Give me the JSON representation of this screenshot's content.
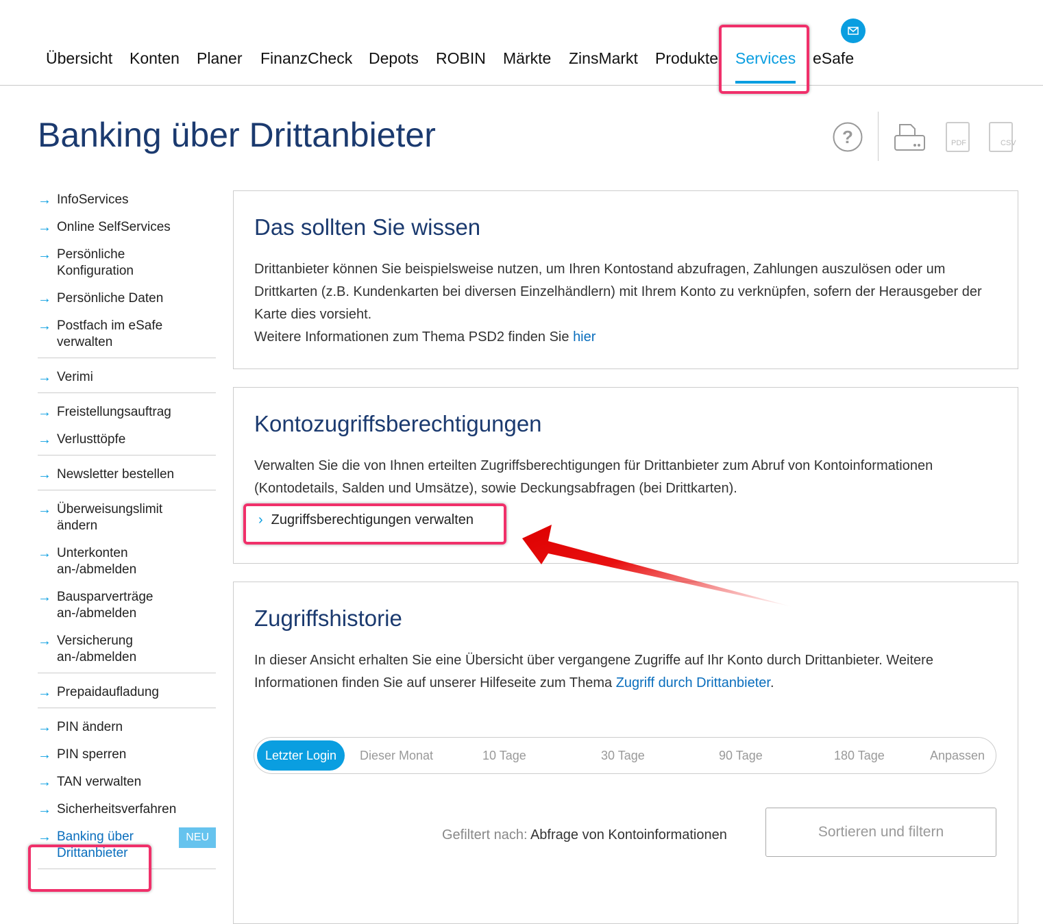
{
  "nav": {
    "items": [
      "Übersicht",
      "Konten",
      "Planer",
      "FinanzCheck",
      "Depots",
      "ROBIN",
      "Märkte",
      "ZinsMarkt",
      "Produkte",
      "Services",
      "eSafe"
    ],
    "active": "Services"
  },
  "page_title": "Banking über Drittanbieter",
  "tools": {
    "pdf": "PDF",
    "csv": "CSV",
    "help": "?"
  },
  "sidebar": {
    "groups": [
      [
        "InfoServices",
        "Online SelfServices",
        "Persönliche\nKonfiguration",
        "Persönliche Daten",
        "Postfach im eSafe\nverwalten"
      ],
      [
        "Verimi"
      ],
      [
        "Freistellungsauftrag",
        "Verlusttöpfe"
      ],
      [
        "Newsletter bestellen"
      ],
      [
        "Überweisungslimit\nändern",
        "Unterkonten\nan-/abmelden",
        "Bausparverträge\nan-/abmelden",
        "Versicherung\nan-/abmelden"
      ],
      [
        "Prepaidaufladung"
      ],
      [
        "PIN ändern",
        "PIN sperren",
        "TAN verwalten",
        "Sicherheitsverfahren",
        "Banking über\nDrittanbieter"
      ]
    ],
    "active": "Banking über\nDrittanbieter",
    "badge": "NEU"
  },
  "card1": {
    "title": "Das sollten Sie wissen",
    "text": "Drittanbieter können Sie beispielsweise nutzen, um Ihren Kontostand abzufragen, Zahlungen auszulösen oder um Drittkarten (z.B. Kundenkarten bei diversen Einzelhändlern) mit Ihrem Konto zu verknüpfen, sofern der Herausgeber der Karte dies vorsieht.",
    "more": "Weitere Informationen zum Thema PSD2 finden Sie ",
    "link": "hier"
  },
  "card2": {
    "title": "Kontozugriffsberechtigungen",
    "text": "Verwalten Sie die von Ihnen erteilten Zugriffsberechtigungen für Drittanbieter zum Abruf von Kontoinformationen (Kontodetails, Salden und Umsätze), sowie Deckungsabfragen (bei Drittkarten).",
    "link": "Zugriffsberechtigungen verwalten"
  },
  "card3": {
    "title": "Zugriffshistorie",
    "text": "In dieser Ansicht erhalten Sie eine Übersicht über vergangene Zugriffe auf Ihr Konto durch Drittanbieter. Weitere Informationen finden Sie auf unserer Hilfeseite zum Thema ",
    "link": "Zugriff durch Drittanbieter",
    "after": ".",
    "tabs": [
      "Letzter Login",
      "Dieser Monat",
      "10 Tage",
      "30 Tage",
      "90 Tage",
      "180 Tage",
      "Anpassen"
    ],
    "active_tab": "Letzter Login",
    "filter_label": "Gefiltert nach: ",
    "filter_value": "Abfrage von Kontoinformationen",
    "sort_button": "Sortieren und filtern"
  },
  "colors": {
    "accent": "#0a9ee0",
    "title": "#1b3a6f",
    "link": "#0a6ebd",
    "highlight": "#f0306a",
    "arrow": "#e81010"
  }
}
